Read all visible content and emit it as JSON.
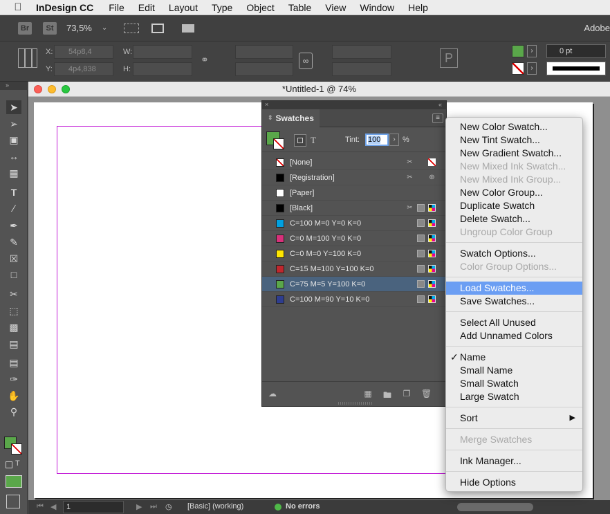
{
  "menubar": {
    "app": "InDesign CC",
    "items": [
      "File",
      "Edit",
      "Layout",
      "Type",
      "Object",
      "Table",
      "View",
      "Window",
      "Help"
    ]
  },
  "appbar": {
    "br": "Br",
    "st": "St",
    "zoom": "73,5%",
    "brand": "Adobe"
  },
  "control": {
    "x_label": "X:",
    "y_label": "Y:",
    "x_value": "54p8,4",
    "y_value": "4p4,838",
    "w_label": "W:",
    "h_label": "H:",
    "stroke_weight": "0 pt"
  },
  "document": {
    "title": "*Untitled-1 @ 74%"
  },
  "status": {
    "page": "1",
    "style": "[Basic] (working)",
    "errors": "No errors"
  },
  "swatches": {
    "title": "Swatches",
    "tint_label": "Tint:",
    "tint_value": "100",
    "tint_unit": "%",
    "type_glyph": "T",
    "rows": [
      {
        "name": "[None]",
        "color": "none"
      },
      {
        "name": "[Registration]",
        "color": "#000000"
      },
      {
        "name": "[Paper]",
        "color": "#ffffff"
      },
      {
        "name": "[Black]",
        "color": "#000000"
      },
      {
        "name": "C=100 M=0 Y=0 K=0",
        "color": "#00a0e0"
      },
      {
        "name": "C=0 M=100 Y=0 K=0",
        "color": "#d8307a"
      },
      {
        "name": "C=0 M=0 Y=100 K=0",
        "color": "#ffe600"
      },
      {
        "name": "C=15 M=100 Y=100 K=0",
        "color": "#c0272d"
      },
      {
        "name": "C=75 M=5 Y=100 K=0",
        "color": "#5aa74a"
      },
      {
        "name": "C=100 M=90 Y=10 K=0",
        "color": "#2e3d8f"
      }
    ],
    "selected_index": 8
  },
  "menu": {
    "items": [
      {
        "label": "New Color Swatch...",
        "enabled": true
      },
      {
        "label": "New Tint Swatch...",
        "enabled": true
      },
      {
        "label": "New Gradient Swatch...",
        "enabled": true
      },
      {
        "label": "New Mixed Ink Swatch...",
        "enabled": false
      },
      {
        "label": "New Mixed Ink Group...",
        "enabled": false
      },
      {
        "label": "New Color Group...",
        "enabled": true
      },
      {
        "label": "Duplicate Swatch",
        "enabled": true
      },
      {
        "label": "Delete Swatch...",
        "enabled": true
      },
      {
        "label": "Ungroup Color Group",
        "enabled": false
      },
      {
        "label": "Swatch Options...",
        "enabled": true
      },
      {
        "label": "Color Group Options...",
        "enabled": false
      },
      {
        "label": "Load Swatches...",
        "enabled": true,
        "highlighted": true
      },
      {
        "label": "Save Swatches...",
        "enabled": true
      },
      {
        "label": "Select All Unused",
        "enabled": true
      },
      {
        "label": "Add Unnamed Colors",
        "enabled": true
      },
      {
        "label": "Name",
        "enabled": true,
        "checked": true
      },
      {
        "label": "Small Name",
        "enabled": true
      },
      {
        "label": "Small Swatch",
        "enabled": true
      },
      {
        "label": "Large Swatch",
        "enabled": true
      },
      {
        "label": "Sort",
        "enabled": true,
        "submenu": true
      },
      {
        "label": "Merge Swatches",
        "enabled": false
      },
      {
        "label": "Ink Manager...",
        "enabled": true
      },
      {
        "label": "Hide Options",
        "enabled": true
      }
    ]
  },
  "colors": {
    "fill": "#5aa74a",
    "margin_guide": "#c21bd6",
    "highlight": "#6b9ef3"
  }
}
